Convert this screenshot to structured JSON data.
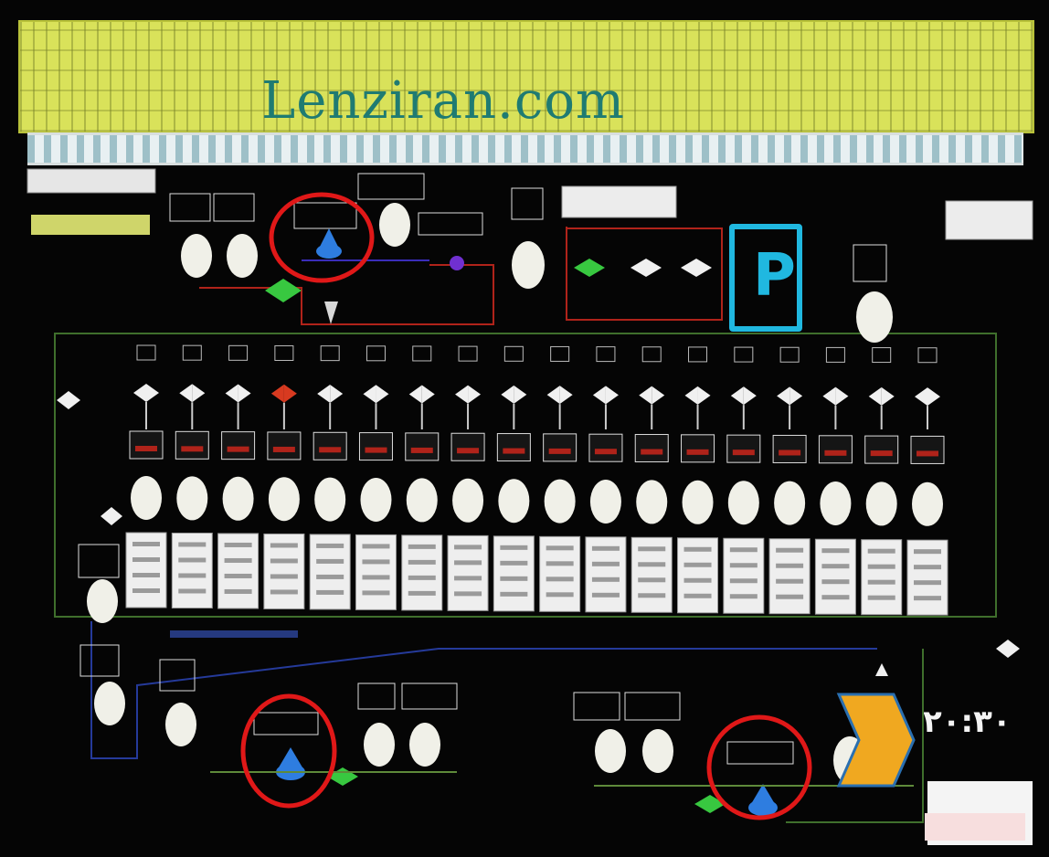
{
  "banner": {
    "site_title": "Lenziran.com"
  },
  "mode_indicator": {
    "letter": "P",
    "color": "#20b8e0"
  },
  "timer": {
    "value": "۲۰:۳۰"
  },
  "zone_count": 18,
  "highlight_color": "#e01818",
  "pipe_colors": {
    "red": "#b0231a",
    "blue": "#1e2f9a",
    "green": "#2e6a2a"
  },
  "valve_colors": {
    "blue": "#2e7de0",
    "green": "#38c840",
    "purple": "#7030d0",
    "red": "#d83a20"
  },
  "arrow_color": "#f0a820"
}
